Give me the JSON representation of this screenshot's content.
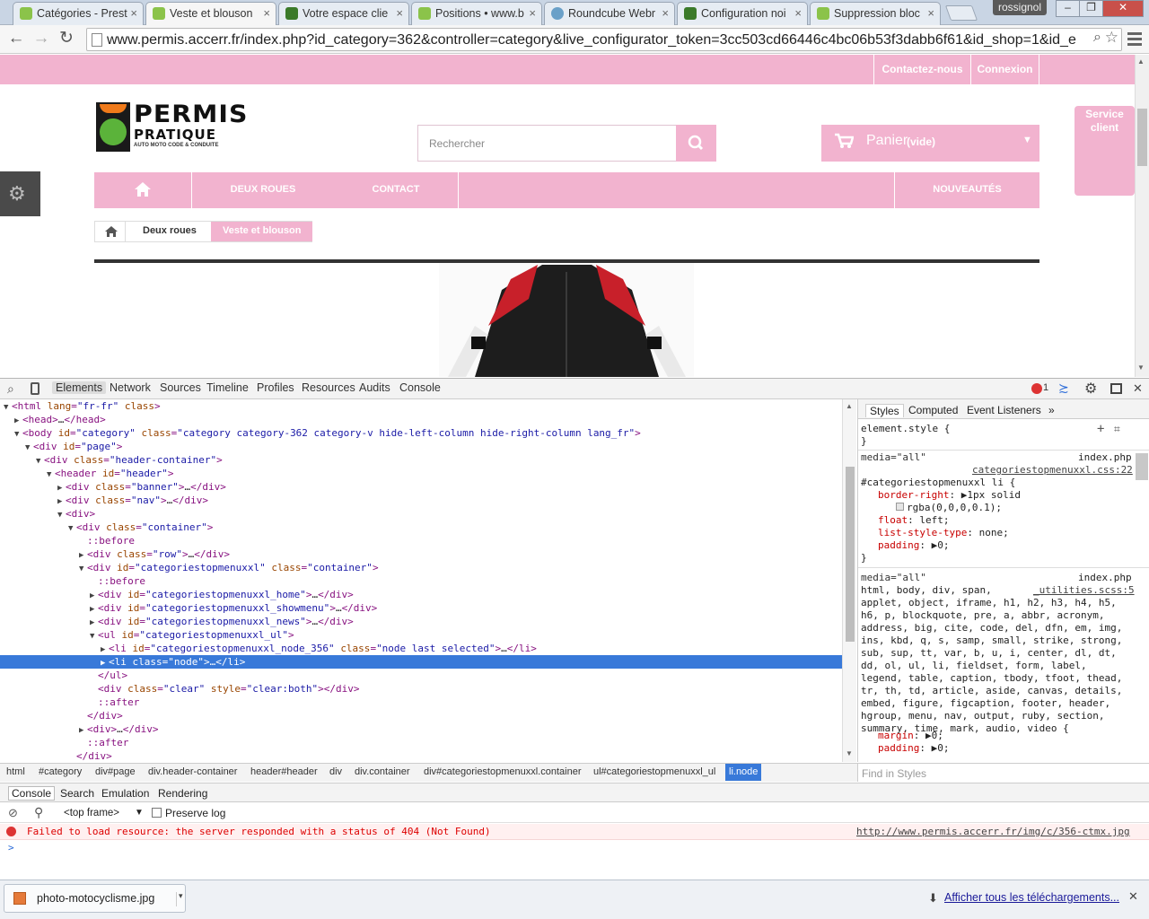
{
  "browser": {
    "tabs": [
      {
        "label": "Catégories - Prest",
        "favicon_color": "#8bc34a",
        "active": false
      },
      {
        "label": "Veste et blouson",
        "favicon_color": "#8bc34a",
        "active": true
      },
      {
        "label": "Votre espace clie",
        "favicon_color": "#3b7a2a",
        "active": false
      },
      {
        "label": "Positions • www.b",
        "favicon_color": "#8bc34a",
        "active": false
      },
      {
        "label": "Roundcube Webr",
        "favicon_color": "#6aa0c8",
        "active": false
      },
      {
        "label": "Configuration noi",
        "favicon_color": "#3b7a2a",
        "active": false
      },
      {
        "label": "Suppression bloc",
        "favicon_color": "#8bc34a",
        "active": false
      }
    ],
    "user": "rossignol",
    "url": "www.permis.accerr.fr/index.php?id_category=362&controller=category&live_configurator_token=3cc503cd66446c4bc06b53f3dabb6f61&id_shop=1&id_e"
  },
  "site": {
    "top_links": [
      "Contactez-nous",
      "Connexion"
    ],
    "logo_main": "PERMIS",
    "logo_sub": "PRATIQUE",
    "logo_tagline": "AUTO MOTO CODE & CONDUITE",
    "search_placeholder": "Rechercher",
    "cart_label": "Panier",
    "cart_status": "(vide)",
    "service_client": "Service client",
    "menu": [
      "DEUX ROUES",
      "CONTACT",
      "NOUVEAUTÉS"
    ],
    "breadcrumb": [
      "Deux roues",
      "Veste et blouson"
    ],
    "accent_color": "#f2b3cf"
  },
  "devtools": {
    "tabs": [
      "Elements",
      "Network",
      "Sources",
      "Timeline",
      "Profiles",
      "Resources",
      "Audits",
      "Console"
    ],
    "error_count": "1",
    "dom_lines": [
      {
        "indent": 0,
        "tri": "▼",
        "parts": [
          [
            "tg",
            "<html "
          ],
          [
            "at",
            "lang"
          ],
          [
            "tg",
            "="
          ],
          [
            "av",
            "\"fr-fr\""
          ],
          [
            "tg",
            " "
          ],
          [
            "at",
            "class"
          ],
          [
            "tg",
            ">"
          ]
        ]
      },
      {
        "indent": 1,
        "tri": "▶",
        "parts": [
          [
            "tg",
            "<head>"
          ],
          [
            "",
            "…"
          ],
          [
            "tg",
            "</head>"
          ]
        ]
      },
      {
        "indent": 1,
        "tri": "▼",
        "parts": [
          [
            "tg",
            "<body "
          ],
          [
            "at",
            "id"
          ],
          [
            "tg",
            "="
          ],
          [
            "av",
            "\"category\""
          ],
          [
            "tg",
            " "
          ],
          [
            "at",
            "class"
          ],
          [
            "tg",
            "="
          ],
          [
            "av",
            "\"category category-362 category-v hide-left-column hide-right-column lang_fr\""
          ],
          [
            "tg",
            ">"
          ]
        ]
      },
      {
        "indent": 2,
        "tri": "▼",
        "parts": [
          [
            "tg",
            "<div "
          ],
          [
            "at",
            "id"
          ],
          [
            "tg",
            "="
          ],
          [
            "av",
            "\"page\""
          ],
          [
            "tg",
            ">"
          ]
        ]
      },
      {
        "indent": 3,
        "tri": "▼",
        "parts": [
          [
            "tg",
            "<div "
          ],
          [
            "at",
            "class"
          ],
          [
            "tg",
            "="
          ],
          [
            "av",
            "\"header-container\""
          ],
          [
            "tg",
            ">"
          ]
        ]
      },
      {
        "indent": 4,
        "tri": "▼",
        "parts": [
          [
            "tg",
            "<header "
          ],
          [
            "at",
            "id"
          ],
          [
            "tg",
            "="
          ],
          [
            "av",
            "\"header\""
          ],
          [
            "tg",
            ">"
          ]
        ]
      },
      {
        "indent": 5,
        "tri": "▶",
        "parts": [
          [
            "tg",
            "<div "
          ],
          [
            "at",
            "class"
          ],
          [
            "tg",
            "="
          ],
          [
            "av",
            "\"banner\""
          ],
          [
            "tg",
            ">"
          ],
          [
            "",
            "…"
          ],
          [
            "tg",
            "</div>"
          ]
        ]
      },
      {
        "indent": 5,
        "tri": "▶",
        "parts": [
          [
            "tg",
            "<div "
          ],
          [
            "at",
            "class"
          ],
          [
            "tg",
            "="
          ],
          [
            "av",
            "\"nav\""
          ],
          [
            "tg",
            ">"
          ],
          [
            "",
            "…"
          ],
          [
            "tg",
            "</div>"
          ]
        ]
      },
      {
        "indent": 5,
        "tri": "▼",
        "parts": [
          [
            "tg",
            "<div>"
          ]
        ]
      },
      {
        "indent": 6,
        "tri": "▼",
        "parts": [
          [
            "tg",
            "<div "
          ],
          [
            "at",
            "class"
          ],
          [
            "tg",
            "="
          ],
          [
            "av",
            "\"container\""
          ],
          [
            "tg",
            ">"
          ]
        ]
      },
      {
        "indent": 7,
        "tri": "",
        "parts": [
          [
            "ps",
            "::before"
          ]
        ]
      },
      {
        "indent": 7,
        "tri": "▶",
        "parts": [
          [
            "tg",
            "<div "
          ],
          [
            "at",
            "class"
          ],
          [
            "tg",
            "="
          ],
          [
            "av",
            "\"row\""
          ],
          [
            "tg",
            ">"
          ],
          [
            "",
            "…"
          ],
          [
            "tg",
            "</div>"
          ]
        ]
      },
      {
        "indent": 7,
        "tri": "▼",
        "parts": [
          [
            "tg",
            "<div "
          ],
          [
            "at",
            "id"
          ],
          [
            "tg",
            "="
          ],
          [
            "av",
            "\"categoriestopmenuxxl\""
          ],
          [
            "tg",
            " "
          ],
          [
            "at",
            "class"
          ],
          [
            "tg",
            "="
          ],
          [
            "av",
            "\"container\""
          ],
          [
            "tg",
            ">"
          ]
        ]
      },
      {
        "indent": 8,
        "tri": "",
        "parts": [
          [
            "ps",
            "::before"
          ]
        ]
      },
      {
        "indent": 8,
        "tri": "▶",
        "parts": [
          [
            "tg",
            "<div "
          ],
          [
            "at",
            "id"
          ],
          [
            "tg",
            "="
          ],
          [
            "av",
            "\"categoriestopmenuxxl_home\""
          ],
          [
            "tg",
            ">"
          ],
          [
            "",
            "…"
          ],
          [
            "tg",
            "</div>"
          ]
        ]
      },
      {
        "indent": 8,
        "tri": "▶",
        "parts": [
          [
            "tg",
            "<div "
          ],
          [
            "at",
            "id"
          ],
          [
            "tg",
            "="
          ],
          [
            "av",
            "\"categoriestopmenuxxl_showmenu\""
          ],
          [
            "tg",
            ">"
          ],
          [
            "",
            "…"
          ],
          [
            "tg",
            "</div>"
          ]
        ]
      },
      {
        "indent": 8,
        "tri": "▶",
        "parts": [
          [
            "tg",
            "<div "
          ],
          [
            "at",
            "id"
          ],
          [
            "tg",
            "="
          ],
          [
            "av",
            "\"categoriestopmenuxxl_news\""
          ],
          [
            "tg",
            ">"
          ],
          [
            "",
            "…"
          ],
          [
            "tg",
            "</div>"
          ]
        ]
      },
      {
        "indent": 8,
        "tri": "▼",
        "parts": [
          [
            "tg",
            "<ul "
          ],
          [
            "at",
            "id"
          ],
          [
            "tg",
            "="
          ],
          [
            "av",
            "\"categoriestopmenuxxl_ul\""
          ],
          [
            "tg",
            ">"
          ]
        ]
      },
      {
        "indent": 9,
        "tri": "▶",
        "parts": [
          [
            "tg",
            "<li "
          ],
          [
            "at",
            "id"
          ],
          [
            "tg",
            "="
          ],
          [
            "av",
            "\"categoriestopmenuxxl_node_356\""
          ],
          [
            "tg",
            " "
          ],
          [
            "at",
            "class"
          ],
          [
            "tg",
            "="
          ],
          [
            "av",
            "\"node last selected\""
          ],
          [
            "tg",
            ">"
          ],
          [
            "",
            "…"
          ],
          [
            "tg",
            "</li>"
          ]
        ]
      },
      {
        "indent": 9,
        "tri": "▶",
        "sel": true,
        "parts": [
          [
            "tg",
            "<li "
          ],
          [
            "at",
            "class"
          ],
          [
            "tg",
            "="
          ],
          [
            "av",
            "\"node\""
          ],
          [
            "tg",
            ">"
          ],
          [
            "",
            "…"
          ],
          [
            "tg",
            "</li>"
          ]
        ]
      },
      {
        "indent": 8,
        "tri": "",
        "parts": [
          [
            "tg",
            "</ul>"
          ]
        ]
      },
      {
        "indent": 8,
        "tri": "",
        "parts": [
          [
            "tg",
            "<div "
          ],
          [
            "at",
            "class"
          ],
          [
            "tg",
            "="
          ],
          [
            "av",
            "\"clear\""
          ],
          [
            "tg",
            " "
          ],
          [
            "at",
            "style"
          ],
          [
            "tg",
            "="
          ],
          [
            "av",
            "\"clear:both\""
          ],
          [
            "tg",
            ">"
          ],
          [
            "tg",
            "</div>"
          ]
        ]
      },
      {
        "indent": 8,
        "tri": "",
        "parts": [
          [
            "ps",
            "::after"
          ]
        ]
      },
      {
        "indent": 7,
        "tri": "",
        "parts": [
          [
            "tg",
            "</div>"
          ]
        ]
      },
      {
        "indent": 7,
        "tri": "▶",
        "parts": [
          [
            "tg",
            "<div>"
          ],
          [
            "",
            "…"
          ],
          [
            "tg",
            "</div>"
          ]
        ]
      },
      {
        "indent": 7,
        "tri": "",
        "parts": [
          [
            "ps",
            "::after"
          ]
        ]
      },
      {
        "indent": 6,
        "tri": "",
        "parts": [
          [
            "tg",
            "</div>"
          ]
        ]
      }
    ],
    "styles_tabs": [
      "Styles",
      "Computed",
      "Event Listeners",
      "»"
    ],
    "element_style": "element.style {",
    "rule1": {
      "media": "media=\"all\"",
      "source_file": "index.php",
      "source_css": "categoriestopmenuxxl.css:22",
      "selector": "#categoriestopmenuxxl li {",
      "props": [
        [
          "border-right",
          "▶1px solid"
        ],
        [
          "",
          "rgba(0,0,0,0.1);"
        ],
        [
          "float",
          "left;"
        ],
        [
          "list-style-type",
          "none;"
        ],
        [
          "padding",
          "▶0;"
        ]
      ]
    },
    "rule2": {
      "media": "media=\"all\"",
      "source_file": "index.php",
      "source_css": "_utilities.scss:5",
      "selector_lines": [
        "html, body, div, span,",
        "applet, object, iframe, h1, h2, h3, h4, h5,",
        "h6, p, blockquote, pre, a, abbr, acronym,",
        "address, big, cite, code, del, dfn, em, img,",
        "ins, kbd, q, s, samp, small, strike, strong,",
        "sub, sup, tt, var, b, u, i, center, dl, dt,",
        "dd, ol, ul, li, fieldset, form, label,",
        "legend, table, caption, tbody, tfoot, thead,",
        "tr, th, td, article, aside, canvas, details,",
        "embed, figure, figcaption, footer, header,",
        "hgroup, menu, nav, output, ruby, section,",
        "summary, time, mark, audio, video {"
      ],
      "props": [
        [
          "margin",
          "▶0;"
        ],
        [
          "padding",
          "▶0;"
        ]
      ]
    },
    "crumbs": [
      "html",
      "#category",
      "div#page",
      "div.header-container",
      "header#header",
      "div",
      "div.container",
      "div#categoriestopmenuxxl.container",
      "ul#categoriestopmenuxxl_ul",
      "li.node"
    ],
    "find_styles": "Find in Styles",
    "drawer_tabs": [
      "Console",
      "Search",
      "Emulation",
      "Rendering"
    ],
    "frame": "<top frame>",
    "preserve_log": "Preserve log",
    "error_message": "Failed to load resource: the server responded with a status of 404 (Not Found)",
    "error_url": "http://www.permis.accerr.fr/img/c/356-ctmx.jpg",
    "prompt": ">"
  },
  "downloads": {
    "file": "photo-motocyclisme.jpg",
    "show_all": "Afficher tous les téléchargements..."
  }
}
